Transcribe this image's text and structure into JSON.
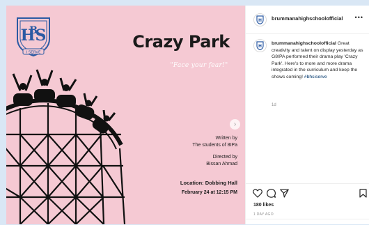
{
  "poster": {
    "title": "Crazy Park",
    "tagline": "\"Face your fear!\"",
    "written_label": "Written by",
    "written_by": "The students of 8IPa",
    "directed_label": "Directed by",
    "directed_by": "Bissan Ahmad",
    "location": "Location: Dobbing Hall",
    "date": "February 24 at 12:15  PM",
    "logo_text": "I SERVE"
  },
  "post": {
    "username": "brummanahighschoolofficial",
    "more_label": "•••",
    "caption_user": "brummanahighschoolofficial",
    "caption_text": " Great creativity and talent on display yesterday as G8IPA performed their drama play 'Crazy Park'. Here's to more and more drama integrated in the curriculum and keep the shows coming! ",
    "hashtag": "#bhsiserve",
    "age": "1d",
    "likes": "180 likes",
    "posted": "1 DAY AGO"
  },
  "icons": [
    "heart-icon",
    "comment-icon",
    "share-icon",
    "bookmark-icon",
    "chevron-right-icon"
  ],
  "colors": {
    "poster_bg": "#f5c9d3",
    "page_bg": "#d9e7f5",
    "logo_blue": "#2b5aa3"
  }
}
